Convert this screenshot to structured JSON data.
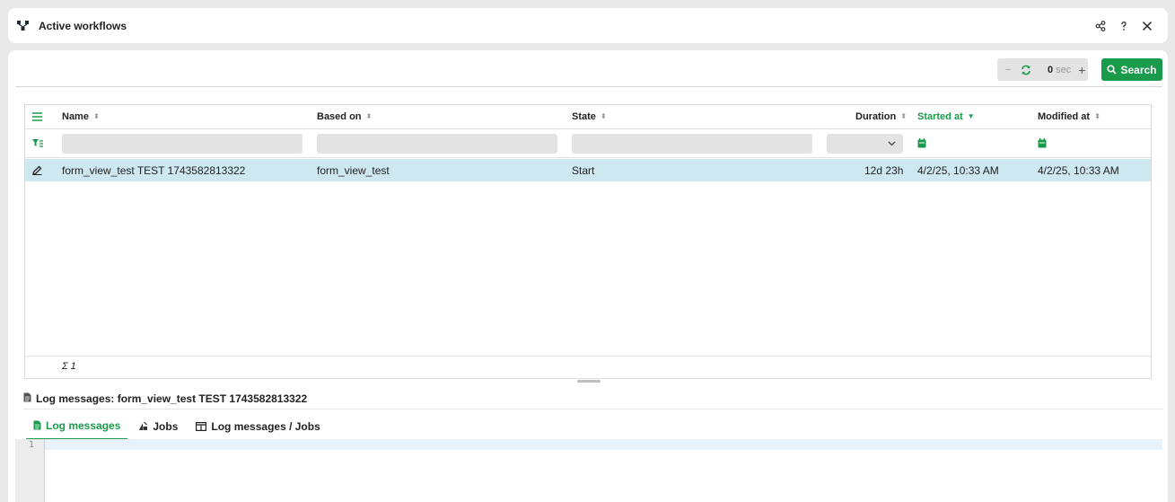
{
  "window": {
    "title": "Active workflows",
    "icons": [
      "workflow-icon",
      "share-icon",
      "help-icon",
      "close-icon"
    ]
  },
  "toolbar": {
    "interval_value": "0",
    "interval_unit": "sec",
    "search_label": "Search"
  },
  "grid": {
    "columns": [
      {
        "label": "Name",
        "sort": "none"
      },
      {
        "label": "Based on",
        "sort": "none"
      },
      {
        "label": "State",
        "sort": "none"
      },
      {
        "label": "Duration",
        "sort": "none"
      },
      {
        "label": "Started at",
        "sort": "desc"
      },
      {
        "label": "Modified at",
        "sort": "none"
      }
    ],
    "rows": [
      {
        "name": "form_view_test TEST 1743582813322",
        "based_on": "form_view_test",
        "state": "Start",
        "duration": "12d 23h",
        "started_at": "4/2/25, 10:33 AM",
        "modified_at": "4/2/25, 10:33 AM",
        "selected": true
      }
    ],
    "footer_sum": "Σ 1"
  },
  "log": {
    "title": "Log messages: form_view_test TEST 1743582813322",
    "tabs": [
      {
        "label": "Log messages",
        "icon": "document-icon",
        "active": true
      },
      {
        "label": "Jobs",
        "icon": "jobs-icon",
        "active": false
      },
      {
        "label": "Log messages / Jobs",
        "icon": "split-view-icon",
        "active": false
      }
    ],
    "line_numbers": [
      "1"
    ]
  },
  "colors": {
    "accent": "#1a9b4b",
    "selected_row": "#cde8f1",
    "background": "#e9e9e9"
  }
}
